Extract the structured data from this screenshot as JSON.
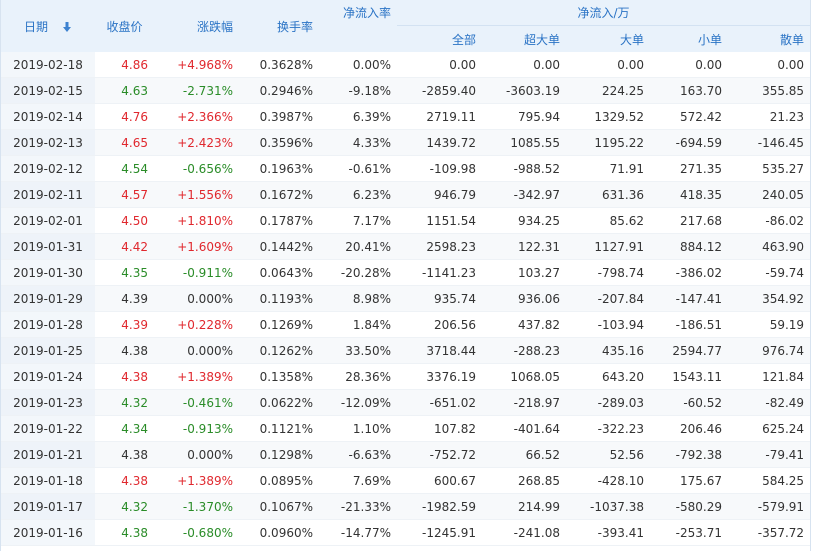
{
  "headers": {
    "date": "日期",
    "close": "收盘价",
    "change": "涨跌幅",
    "turnover": "换手率",
    "net_rate": "净流入率",
    "group": "净流入/万",
    "all": "全部",
    "xlarge": "超大单",
    "large": "大单",
    "small": "小单",
    "retail": "散单"
  },
  "icons": {
    "sort": "sort-down-arrow-icon"
  },
  "colors": {
    "up": "#e0282e",
    "down": "#2a8c28",
    "header_text": "#2a73c5",
    "header_bg": "#e9f2fb"
  },
  "rows": [
    {
      "date": "2019-02-18",
      "close": "4.86",
      "change": "+4.968%",
      "turnover": "0.3628%",
      "net_rate": "0.00%",
      "all": "0.00",
      "xlarge": "0.00",
      "large": "0.00",
      "small": "0.00",
      "retail": "0.00",
      "dir": "up"
    },
    {
      "date": "2019-02-15",
      "close": "4.63",
      "change": "-2.731%",
      "turnover": "0.2946%",
      "net_rate": "-9.18%",
      "all": "-2859.40",
      "xlarge": "-3603.19",
      "large": "224.25",
      "small": "163.70",
      "retail": "355.85",
      "dir": "down"
    },
    {
      "date": "2019-02-14",
      "close": "4.76",
      "change": "+2.366%",
      "turnover": "0.3987%",
      "net_rate": "6.39%",
      "all": "2719.11",
      "xlarge": "795.94",
      "large": "1329.52",
      "small": "572.42",
      "retail": "21.23",
      "dir": "up"
    },
    {
      "date": "2019-02-13",
      "close": "4.65",
      "change": "+2.423%",
      "turnover": "0.3596%",
      "net_rate": "4.33%",
      "all": "1439.72",
      "xlarge": "1085.55",
      "large": "1195.22",
      "small": "-694.59",
      "retail": "-146.45",
      "dir": "up"
    },
    {
      "date": "2019-02-12",
      "close": "4.54",
      "change": "-0.656%",
      "turnover": "0.1963%",
      "net_rate": "-0.61%",
      "all": "-109.98",
      "xlarge": "-988.52",
      "large": "71.91",
      "small": "271.35",
      "retail": "535.27",
      "dir": "down"
    },
    {
      "date": "2019-02-11",
      "close": "4.57",
      "change": "+1.556%",
      "turnover": "0.1672%",
      "net_rate": "6.23%",
      "all": "946.79",
      "xlarge": "-342.97",
      "large": "631.36",
      "small": "418.35",
      "retail": "240.05",
      "dir": "up"
    },
    {
      "date": "2019-02-01",
      "close": "4.50",
      "change": "+1.810%",
      "turnover": "0.1787%",
      "net_rate": "7.17%",
      "all": "1151.54",
      "xlarge": "934.25",
      "large": "85.62",
      "small": "217.68",
      "retail": "-86.02",
      "dir": "up"
    },
    {
      "date": "2019-01-31",
      "close": "4.42",
      "change": "+1.609%",
      "turnover": "0.1442%",
      "net_rate": "20.41%",
      "all": "2598.23",
      "xlarge": "122.31",
      "large": "1127.91",
      "small": "884.12",
      "retail": "463.90",
      "dir": "up"
    },
    {
      "date": "2019-01-30",
      "close": "4.35",
      "change": "-0.911%",
      "turnover": "0.0643%",
      "net_rate": "-20.28%",
      "all": "-1141.23",
      "xlarge": "103.27",
      "large": "-798.74",
      "small": "-386.02",
      "retail": "-59.74",
      "dir": "down"
    },
    {
      "date": "2019-01-29",
      "close": "4.39",
      "change": "0.000%",
      "turnover": "0.1193%",
      "net_rate": "8.98%",
      "all": "935.74",
      "xlarge": "936.06",
      "large": "-207.84",
      "small": "-147.41",
      "retail": "354.92",
      "dir": "flat"
    },
    {
      "date": "2019-01-28",
      "close": "4.39",
      "change": "+0.228%",
      "turnover": "0.1269%",
      "net_rate": "1.84%",
      "all": "206.56",
      "xlarge": "437.82",
      "large": "-103.94",
      "small": "-186.51",
      "retail": "59.19",
      "dir": "up"
    },
    {
      "date": "2019-01-25",
      "close": "4.38",
      "change": "0.000%",
      "turnover": "0.1262%",
      "net_rate": "33.50%",
      "all": "3718.44",
      "xlarge": "-288.23",
      "large": "435.16",
      "small": "2594.77",
      "retail": "976.74",
      "dir": "flat"
    },
    {
      "date": "2019-01-24",
      "close": "4.38",
      "change": "+1.389%",
      "turnover": "0.1358%",
      "net_rate": "28.36%",
      "all": "3376.19",
      "xlarge": "1068.05",
      "large": "643.20",
      "small": "1543.11",
      "retail": "121.84",
      "dir": "up"
    },
    {
      "date": "2019-01-23",
      "close": "4.32",
      "change": "-0.461%",
      "turnover": "0.0622%",
      "net_rate": "-12.09%",
      "all": "-651.02",
      "xlarge": "-218.97",
      "large": "-289.03",
      "small": "-60.52",
      "retail": "-82.49",
      "dir": "down"
    },
    {
      "date": "2019-01-22",
      "close": "4.34",
      "change": "-0.913%",
      "turnover": "0.1121%",
      "net_rate": "1.10%",
      "all": "107.82",
      "xlarge": "-401.64",
      "large": "-322.23",
      "small": "206.46",
      "retail": "625.24",
      "dir": "down"
    },
    {
      "date": "2019-01-21",
      "close": "4.38",
      "change": "0.000%",
      "turnover": "0.1298%",
      "net_rate": "-6.63%",
      "all": "-752.72",
      "xlarge": "66.52",
      "large": "52.56",
      "small": "-792.38",
      "retail": "-79.41",
      "dir": "flat"
    },
    {
      "date": "2019-01-18",
      "close": "4.38",
      "change": "+1.389%",
      "turnover": "0.0895%",
      "net_rate": "7.69%",
      "all": "600.67",
      "xlarge": "268.85",
      "large": "-428.10",
      "small": "175.67",
      "retail": "584.25",
      "dir": "up"
    },
    {
      "date": "2019-01-17",
      "close": "4.32",
      "change": "-1.370%",
      "turnover": "0.1067%",
      "net_rate": "-21.33%",
      "all": "-1982.59",
      "xlarge": "214.99",
      "large": "-1037.38",
      "small": "-580.29",
      "retail": "-579.91",
      "dir": "down"
    },
    {
      "date": "2019-01-16",
      "close": "4.38",
      "change": "-0.680%",
      "turnover": "0.0960%",
      "net_rate": "-14.77%",
      "all": "-1245.91",
      "xlarge": "-241.08",
      "large": "-393.41",
      "small": "-253.71",
      "retail": "-357.72",
      "dir": "down"
    }
  ]
}
